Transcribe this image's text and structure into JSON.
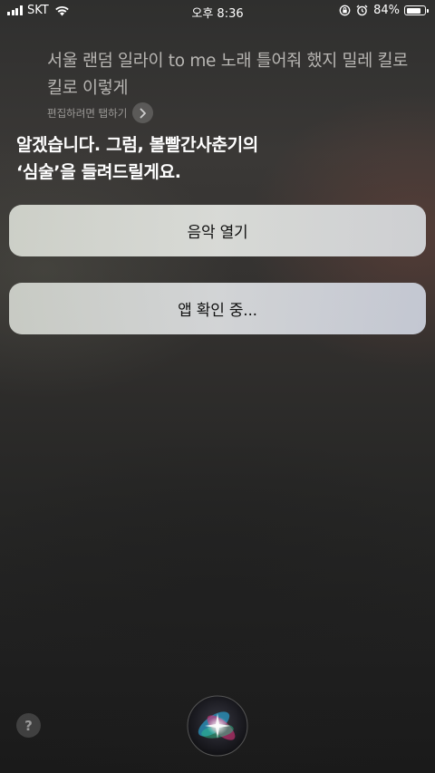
{
  "status_bar": {
    "carrier": "SKT",
    "time": "오후 8:36",
    "battery_percent": "84%",
    "battery_level": 0.84
  },
  "transcript": {
    "text": "서울 랜덤 일라이 to me 노래 틀어줘 했지 밀레 킬로 킬로 이렇게",
    "edit_hint": "편집하려면 탭하기"
  },
  "response": {
    "line1": "알겠습니다. 그럼, 볼빨간사춘기의",
    "line2": "‘심술’을 들려드릴게요."
  },
  "buttons": {
    "open_music": "음악 열기",
    "checking_app": "앱 확인 중..."
  },
  "help": {
    "label": "?"
  },
  "icons": {
    "wifi": "wifi-icon",
    "orientation_lock": "orientation-lock-icon",
    "alarm": "alarm-icon",
    "chevron": "chevron-right-icon",
    "siri": "siri-orb-icon"
  }
}
